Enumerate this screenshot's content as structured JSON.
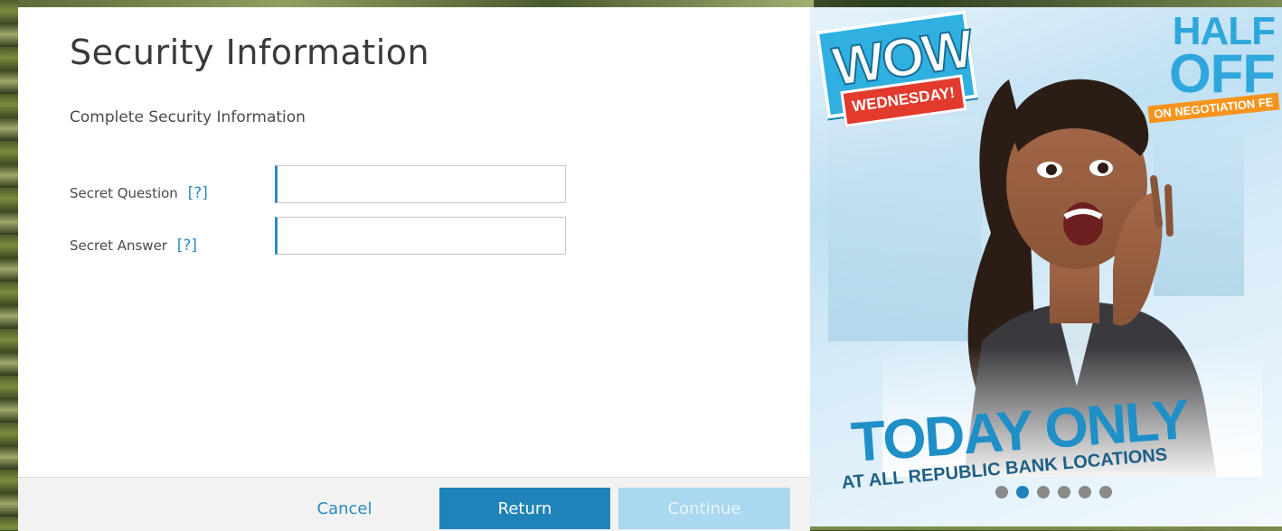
{
  "form": {
    "title": "Security Information",
    "subtitle": "Complete Security Information",
    "fields": [
      {
        "label": "Secret Question",
        "help": "[?]",
        "value": ""
      },
      {
        "label": "Secret Answer",
        "help": "[?]",
        "value": ""
      }
    ]
  },
  "footer": {
    "cancel_label": "Cancel",
    "return_label": "Return",
    "continue_label": "Continue"
  },
  "ad": {
    "wow": "WOW",
    "wednesday": "WEDNESDAY!",
    "half": "HALF",
    "off": "OFF",
    "negotiation": "ON NEGOTIATION FE",
    "today": "TODAY ONLY",
    "locations": "AT ALL REPUBLIC BANK LOCATIONS",
    "carousel_total": 6,
    "carousel_active": 2
  },
  "colors": {
    "accent": "#1f83b9",
    "accent_light": "#a9d8ef",
    "help": "#2a8bc0",
    "wed_red": "#e23a2d",
    "neg_orange": "#f7941d"
  }
}
